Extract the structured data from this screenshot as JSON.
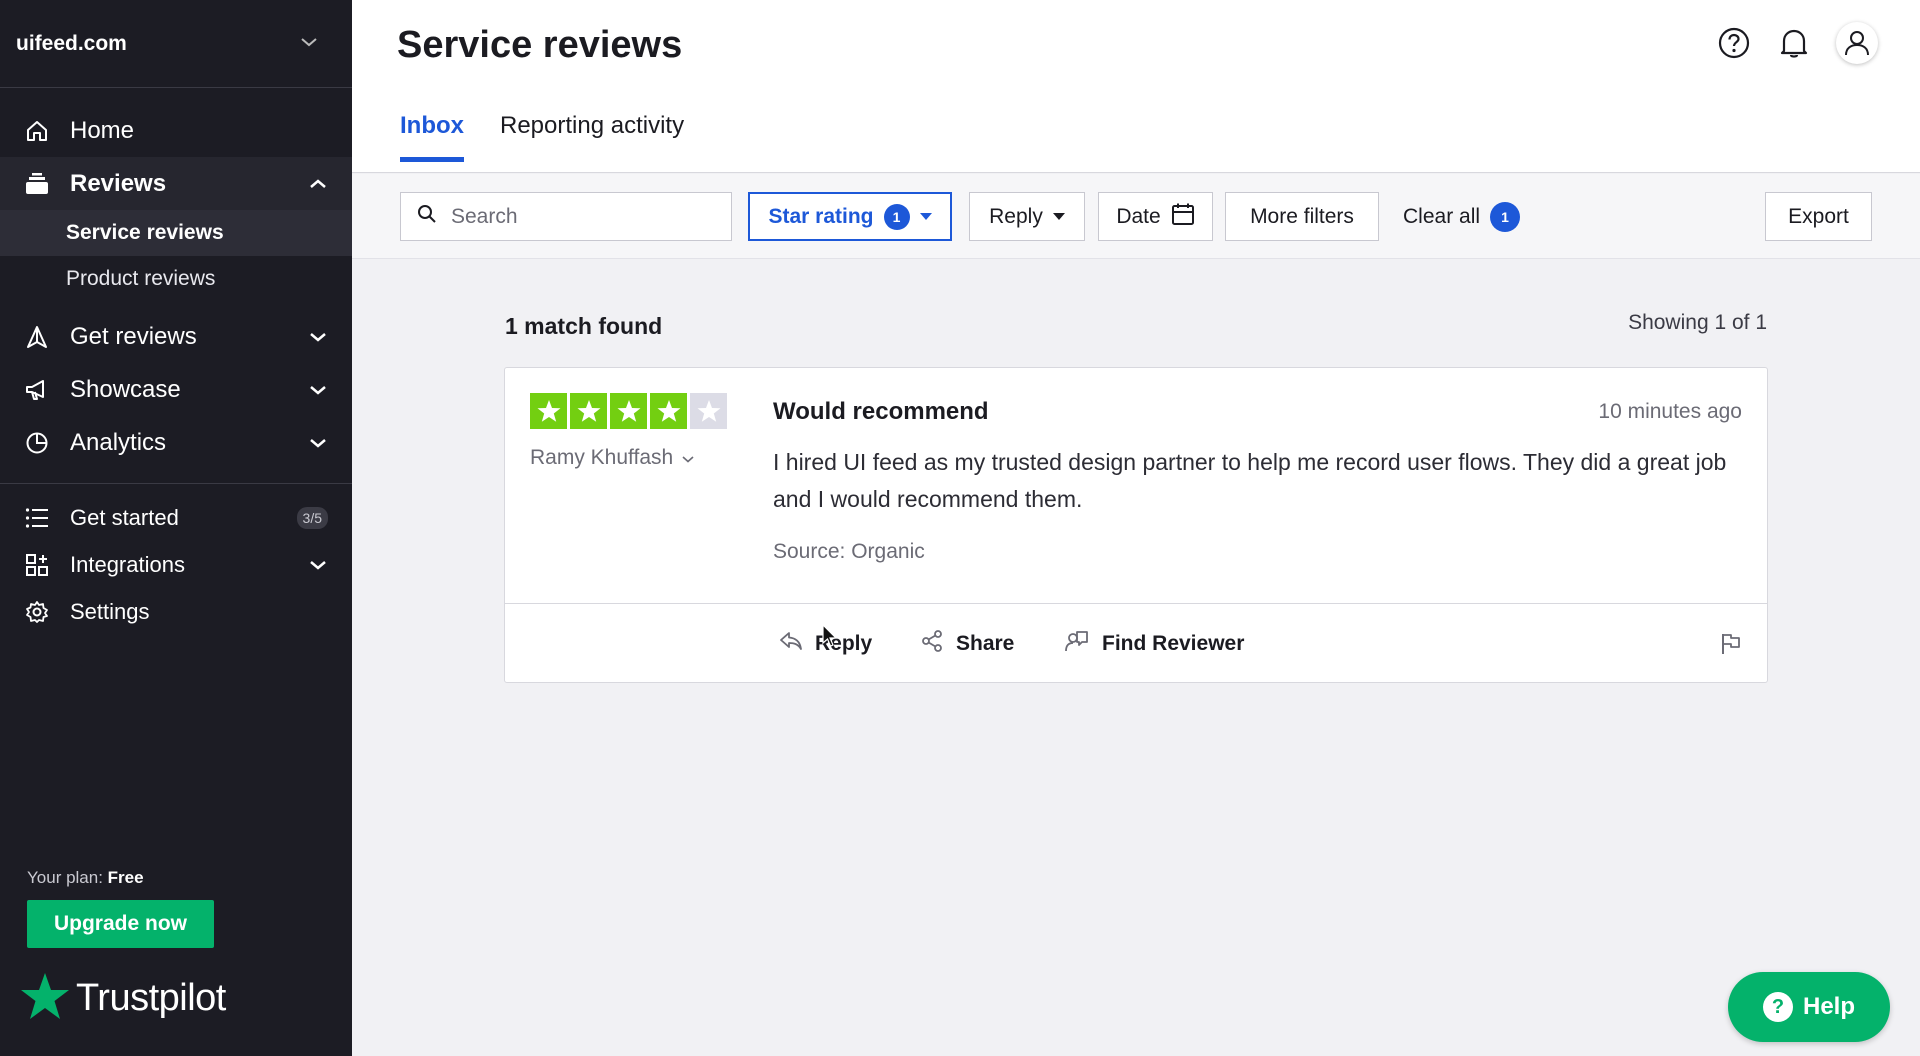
{
  "sidebar": {
    "domain": "uifeed.com",
    "nav": {
      "home": "Home",
      "reviews": "Reviews",
      "service_reviews": "Service reviews",
      "product_reviews": "Product reviews",
      "get_reviews": "Get reviews",
      "showcase": "Showcase",
      "analytics": "Analytics",
      "get_started": "Get started",
      "get_started_progress": "3/5",
      "integrations": "Integrations",
      "settings": "Settings"
    },
    "plan_label": "Your plan:",
    "plan_value": "Free",
    "upgrade_label": "Upgrade now",
    "brand": "Trustpilot",
    "brand_color": "#04b26b"
  },
  "header": {
    "title": "Service reviews",
    "tabs": [
      {
        "label": "Inbox",
        "active": true
      },
      {
        "label": "Reporting activity",
        "active": false
      }
    ]
  },
  "filters": {
    "search_placeholder": "Search",
    "star_rating_label": "Star rating",
    "star_rating_count": "1",
    "reply_label": "Reply",
    "date_label": "Date",
    "more_filters_label": "More filters",
    "clear_all_label": "Clear all",
    "clear_all_count": "1",
    "export_label": "Export",
    "accent_color": "#1d58d8"
  },
  "results": {
    "match_text": "1 match found",
    "showing_text": "Showing 1 of 1"
  },
  "review": {
    "rating": 4,
    "max_rating": 5,
    "star_color": "#73cf11",
    "reviewer": "Ramy Khuffash",
    "title": "Would recommend",
    "time": "10 minutes ago",
    "body": "I hired UI feed as my trusted design partner to help me record user flows. They did a great job and I would recommend them.",
    "source": "Source: Organic",
    "actions": {
      "reply": "Reply",
      "share": "Share",
      "find_reviewer": "Find Reviewer"
    }
  },
  "help_button": "Help"
}
